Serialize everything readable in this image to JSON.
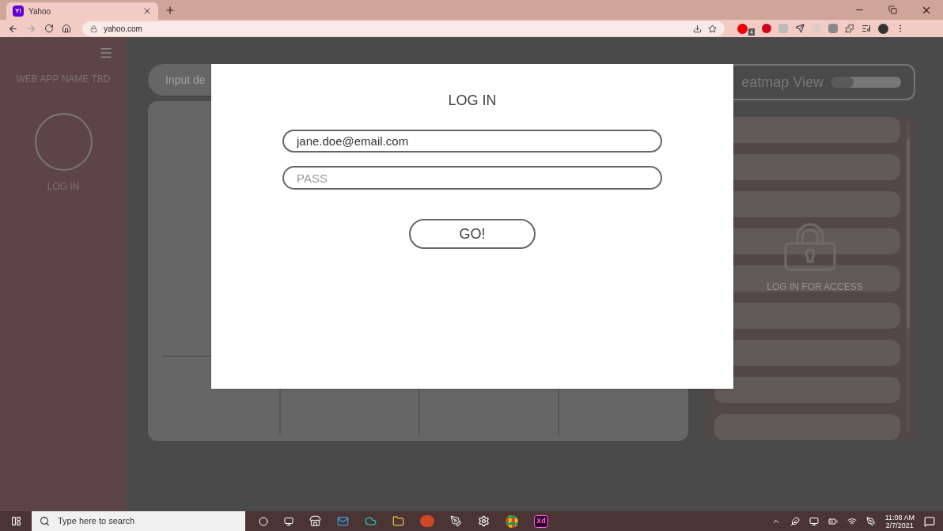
{
  "browser": {
    "tab": {
      "icon_text": "Y!",
      "title": "Yahoo"
    },
    "address": "yahoo.com",
    "extension_badge": "4"
  },
  "sidebar": {
    "app_name": "WEB APP NAME TBD",
    "login_label": "LOG IN"
  },
  "input": {
    "placeholder": "Input de"
  },
  "heatmap_toggle": {
    "label": "eatmap View",
    "on": false
  },
  "locked_panel": {
    "message": "LOG IN FOR ACCESS"
  },
  "login_dialog": {
    "title": "LOG IN",
    "email": {
      "value": "jane.doe@email.com"
    },
    "password": {
      "placeholder": "PASS"
    },
    "submit": "GO!"
  },
  "taskbar": {
    "search_placeholder": "Type here to search",
    "app_icon_text": "Xd",
    "time": "11:08 AM",
    "date": "2/7/2021"
  }
}
